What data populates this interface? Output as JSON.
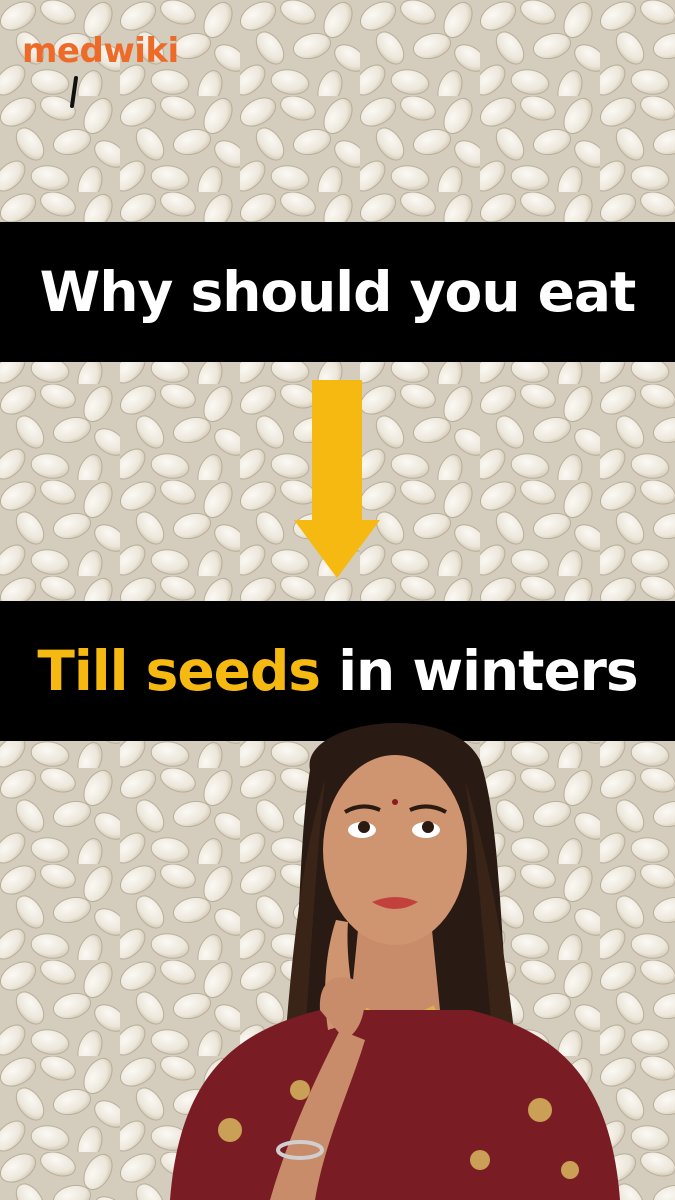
{
  "brand": {
    "logo_text": "medwiki"
  },
  "headline_top": "Why should you eat",
  "headline_bottom": {
    "highlight": "Till seeds",
    "rest": " in winters"
  },
  "icons": {
    "arrow": "down-arrow-icon",
    "logo_mark": "magnifier-icon"
  },
  "colors": {
    "band": "#000000",
    "accent": "#f5b912",
    "logo": "#ee6a28",
    "text": "#ffffff"
  }
}
